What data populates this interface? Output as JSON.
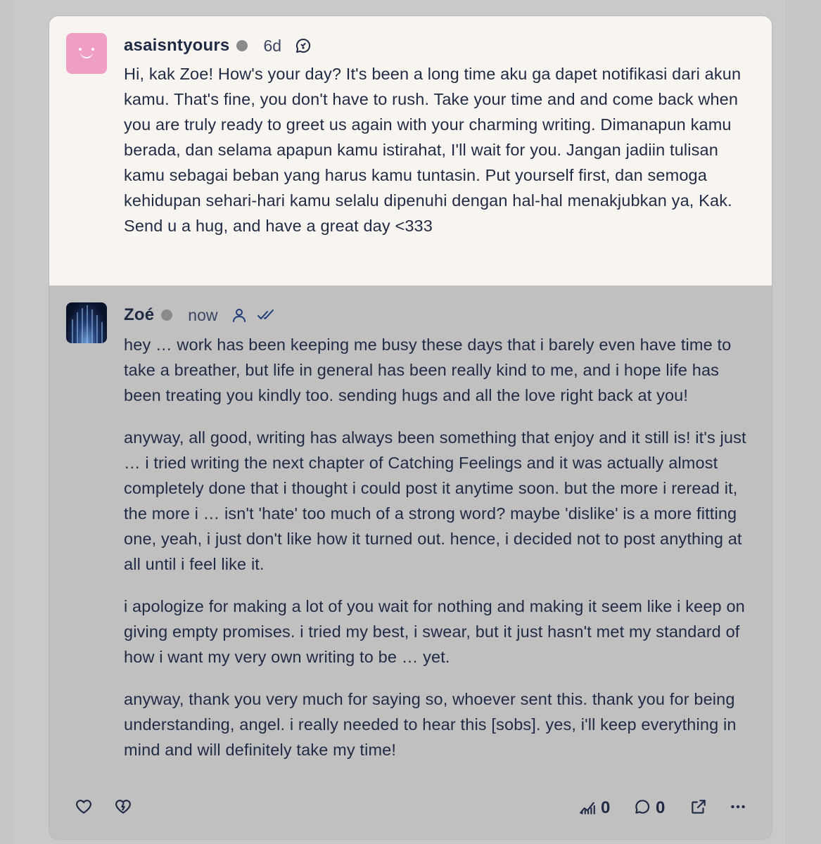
{
  "ask": {
    "username": "asaisntyours",
    "time": "6d",
    "avatar_icon": "smiley-face-avatar",
    "type_icon": "anonymous-ask-bubble-icon",
    "text": "Hi, kak Zoe! How's your day? It's been a long time aku ga dapet notifikasi dari akun kamu. That's fine, you don't have to rush. Take your time and and come back when you are truly ready to greet us again with your charming writing. Dimanapun kamu berada, dan selama apapun kamu istirahat, I'll wait for you. Jangan jadiin tulisan kamu sebagai beban yang harus kamu tuntasin. Put yourself first, dan semoga kehidupan sehari-hari kamu selalu dipenuhi dengan hal-hal menakjubkan ya, Kak. Send u a hug, and have a great day <333",
    "background": "#f8f5f0"
  },
  "answer": {
    "username": "Zoé",
    "time": "now",
    "paragraphs": [
      "hey … work has been keeping me busy these days that i barely even have time to take a breather, but life in general has been really kind to me, and i hope life has been treating you kindly too. sending hugs and all the love right back at you!",
      "anyway, all good, writing has always been something that enjoy and it still is! it's just … i tried writing the next chapter of Catching Feelings and it was actually almost completely done that i thought i could post it anytime soon. but the more i reread it, the more i … isn't 'hate' too much of a strong word? maybe 'dislike' is a more fitting one, yeah, i just don't like how it turned out. hence, i decided not to post anything at all until i feel like it.",
      "i apologize for making a lot of you wait for nothing and making it seem like i keep on giving empty promises. i tried my best, i swear, but it just hasn't met my standard of how i want my very own writing to be … yet.",
      "anyway, thank you very much for saying so, whoever sent this. thank you for being understanding, angel. i really needed to hear this [sobs]. yes, i'll keep everything in mind and will definitely take my time!"
    ]
  },
  "footer": {
    "views_count": "0",
    "comments_count": "0"
  },
  "colors": {
    "text": "#1f2a44",
    "card_background": "#c0c0c0",
    "status_dot": "#8a8a8a",
    "avatar_pink": "#ef9fc4"
  }
}
